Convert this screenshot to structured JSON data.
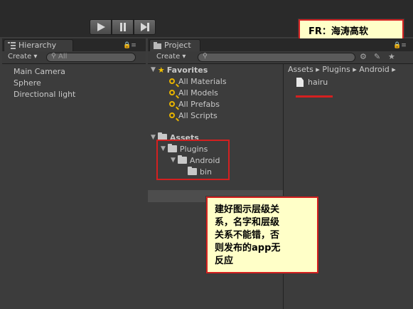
{
  "note_top": "FR：海涛高软",
  "note_main": [
    "建好图示层级关",
    "系，名字和层级",
    "关系不能错，否",
    "则发布的app无",
    "反应"
  ],
  "hierarchy": {
    "tab": "Hierarchy",
    "create": "Create ▾",
    "search": "All",
    "items": [
      "Main Camera",
      "Sphere",
      "Directional light"
    ]
  },
  "project": {
    "tab": "Project",
    "create": "Create ▾",
    "favorites_label": "Favorites",
    "favorites": [
      "All Materials",
      "All Models",
      "All Prefabs",
      "All Scripts"
    ],
    "assets_label": "Assets",
    "tree": [
      "Plugins",
      "Android",
      "bin"
    ],
    "breadcrumb": "Assets ▸ Plugins ▸ Android ▸",
    "file": "hairu"
  }
}
